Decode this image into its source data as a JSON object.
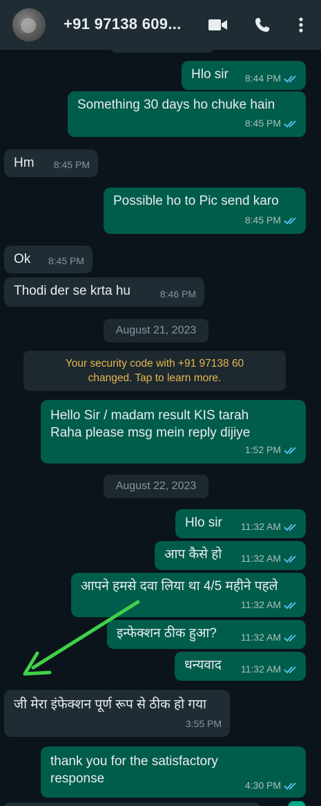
{
  "header": {
    "contact_name": "+91 97138 609...",
    "icons": [
      "video-call-icon",
      "voice-call-icon",
      "more-options-icon"
    ]
  },
  "messages": [
    {
      "dir": "out",
      "text": "Hlo sir",
      "time": "8:44 PM"
    },
    {
      "dir": "out",
      "text": "Something 30 days ho chuke hain",
      "time": "8:45 PM"
    },
    {
      "dir": "in",
      "text": "Hm",
      "time": "8:45 PM"
    },
    {
      "dir": "out",
      "text": "Possible ho to Pic send karo",
      "time": "8:45 PM"
    },
    {
      "dir": "in",
      "text": "Ok",
      "time": "8:45 PM"
    },
    {
      "dir": "in",
      "text": "Thodi der se krta hu",
      "time": "8:46 PM"
    },
    {
      "dir": "out",
      "text": "Hello Sir / madam result KIS tarah Raha please msg mein reply dijiye",
      "time": "1:52 PM"
    },
    {
      "dir": "out",
      "text": "Hlo sir",
      "time": "11:32 AM"
    },
    {
      "dir": "out",
      "text": "आप कैसे हो",
      "time": "11:32 AM"
    },
    {
      "dir": "out",
      "text": "आपने हमसे दवा लिया था 4/5 महीने पहले",
      "time": "11:32 AM"
    },
    {
      "dir": "out",
      "text": "इन्फेक्शन ठीक हुआ?",
      "time": "11:32 AM"
    },
    {
      "dir": "out",
      "text": "धन्यवाद",
      "time": "11:32 AM"
    },
    {
      "dir": "in",
      "text": "जी मेरा इंफेक्शन पूर्ण रूप से ठीक हो गया",
      "time": "3:55 PM"
    },
    {
      "dir": "out",
      "text": "thank you for the satisfactory response",
      "time": "4:30 PM"
    }
  ],
  "dates": [
    "August 21, 2023",
    "August 22, 2023"
  ],
  "system_message": {
    "line1": "Your security code with +91 97138 60",
    "line2": "changed. Tap to learn more."
  },
  "colors": {
    "background": "#0b141a",
    "outgoing_bubble": "#005c4b",
    "incoming_bubble": "#1f2c34",
    "read_ticks": "#53bdeb",
    "annotation_arrow": "#3fd14a"
  }
}
